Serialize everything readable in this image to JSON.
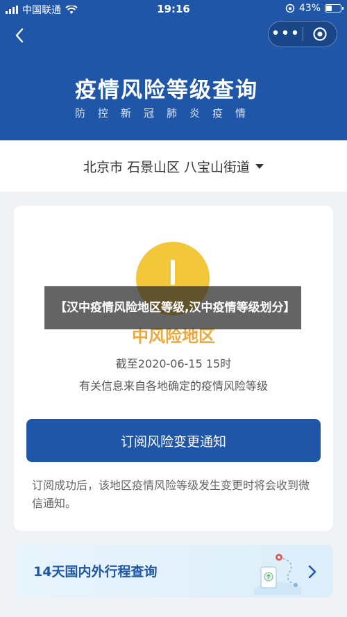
{
  "status_bar": {
    "carrier": "中国联通",
    "time": "19:16",
    "battery": "43%",
    "battery_level": 0.43
  },
  "header": {
    "title": "疫情风险等级查询",
    "subtitle": "防控新冠肺炎疫情"
  },
  "region": {
    "text": "北京市 石景山区 八宝山街道"
  },
  "risk_card": {
    "level_label": "中风险地区",
    "as_of": "截至2020-06-15 15时",
    "source": "有关信息来自各地确定的疫情风险等级",
    "level_color": "#f3c73a",
    "subscribe_button": "订阅风险变更通知",
    "subscribe_note": "订阅成功后，该地区疫情风险等级发生变更时将会收到微信通知。"
  },
  "travel_card": {
    "label": "14天国内外行程查询"
  },
  "overlay": {
    "text": "【汉中疫情风险地区等级,汉中疫情等级划分】"
  },
  "colors": {
    "brand_blue": "#1f56a8",
    "medium_risk_yellow": "#f3c73a",
    "medium_risk_text": "#eda83b"
  }
}
